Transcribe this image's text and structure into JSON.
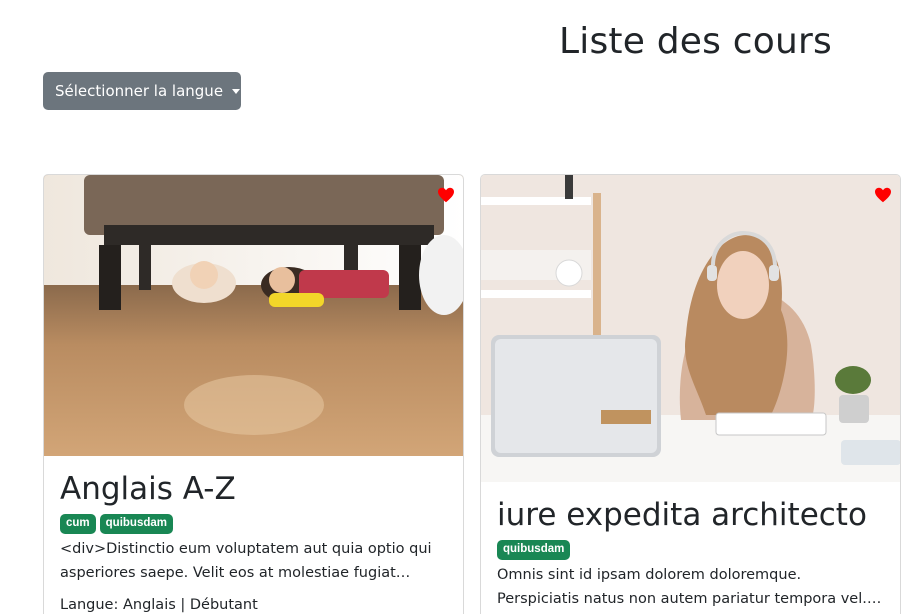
{
  "page": {
    "title": "Liste des cours"
  },
  "language_dropdown": {
    "label": "Sélectionner la langue"
  },
  "courses": [
    {
      "title": "Anglais A-Z",
      "tags": [
        "cum",
        "quibusdam"
      ],
      "description": "<div>Distinctio eum voluptatem aut quia optio qui asperiores saepe. Velit eos at molestiae fugiat fugit.…",
      "meta": "Langue: Anglais | Débutant",
      "favorite_icon": "heart-icon"
    },
    {
      "title": "iure expedita architecto",
      "tags": [
        "quibusdam"
      ],
      "description": "Omnis sint id ipsam dolorem doloremque. Perspiciatis natus non autem pariatur tempora vel. Magnam eum…",
      "favorite_icon": "heart-icon"
    }
  ],
  "colors": {
    "heading": "#212529",
    "dropdown_bg": "#6c757d",
    "badge_bg": "#198754",
    "heart": "#ff0000"
  }
}
